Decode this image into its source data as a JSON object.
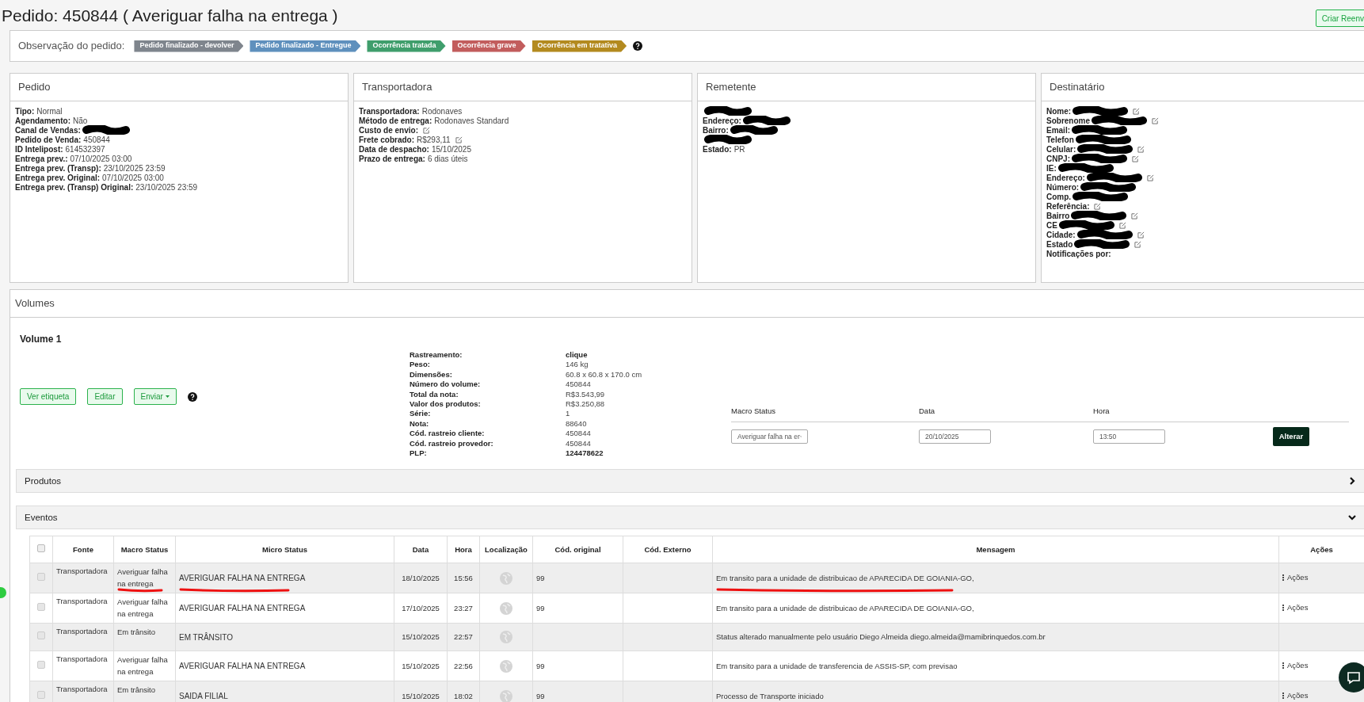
{
  "title": "Pedido: 450844 ( Averiguar falha na entrega )",
  "top_button": "Criar Reenv",
  "observation": {
    "label": "Observação do pedido:",
    "tags": [
      {
        "label": "Pedido finalizado - devolver",
        "color": "#7f858d"
      },
      {
        "label": "Pedido finalizado - Entregue",
        "color": "#5f90bd"
      },
      {
        "label": "Ocorrência tratada",
        "color": "#3f9e6c"
      },
      {
        "label": "Ocorrência grave",
        "color": "#c25d5d"
      },
      {
        "label": "Ocorrência em tratativa",
        "color": "#b38a1f"
      }
    ]
  },
  "panels": [
    {
      "title": "Pedido",
      "fields": [
        {
          "label": "Tipo:",
          "value": "Normal"
        },
        {
          "label": "Agendamento:",
          "value": "Não"
        },
        {
          "label": "Canal de Vendas:",
          "redacted": true
        },
        {
          "label": "Pedido de Venda:",
          "value": "450844"
        },
        {
          "label": "ID Intelipost:",
          "value": "614532397"
        },
        {
          "label": "Entrega prev.:",
          "value": "07/10/2025 03:00"
        },
        {
          "label": "Entrega prev. (Transp):",
          "value": "23/10/2025 23:59"
        },
        {
          "label": "Entrega prev. Original:",
          "value": "07/10/2025 03:00"
        },
        {
          "label": "Entrega prev. (Transp) Original:",
          "value": "23/10/2025 23:59"
        }
      ]
    },
    {
      "title": "Transportadora",
      "fields": [
        {
          "label": "Transportadora:",
          "value": "Rodonaves"
        },
        {
          "label": "Método de entrega:",
          "value": "Rodonaves Standard"
        },
        {
          "label": "Custo de envio:",
          "editable": true
        },
        {
          "label": "Frete cobrado:",
          "value": "R$293,11",
          "editable": true
        },
        {
          "label": "Data de despacho:",
          "value": "15/10/2025"
        },
        {
          "label": "Prazo de entrega:",
          "value": "6 dias úteis"
        }
      ]
    },
    {
      "title": "Remetente",
      "fields": [
        {
          "redacted": true
        },
        {
          "label": "Endereço:",
          "redacted": true
        },
        {
          "label": "Bairro:",
          "redacted": true
        },
        {
          "redacted": true
        },
        {
          "label": "Estado:",
          "value": "PR"
        }
      ]
    },
    {
      "title": "Destinatário",
      "fields": [
        {
          "label": "Nome:",
          "redacted": true,
          "editable": true
        },
        {
          "label": "Sobrenome",
          "redacted": true,
          "editable": true
        },
        {
          "label": "Email:",
          "redacted": true
        },
        {
          "label": "Telefon",
          "redacted": true
        },
        {
          "label": "Celular:",
          "redacted": true,
          "editable": true
        },
        {
          "label": "CNPJ:",
          "redacted": true,
          "editable": true
        },
        {
          "label": "IE:",
          "redacted": true
        },
        {
          "label": "Endereço:",
          "redacted": true,
          "editable": true
        },
        {
          "label": "Número:",
          "redacted": true
        },
        {
          "label": "Comp.",
          "redacted": true
        },
        {
          "label": "Referência:",
          "editable": true
        },
        {
          "label": "Bairro",
          "redacted": true,
          "editable": true
        },
        {
          "label": "CE",
          "redacted": true,
          "editable": true
        },
        {
          "label": "Cidade:",
          "redacted": true,
          "editable": true
        },
        {
          "label": "Estado",
          "redacted": true,
          "editable": true
        },
        {
          "label": "Notificações por:"
        }
      ]
    }
  ],
  "volumes": {
    "title": "Volumes",
    "volume_title": "Volume 1",
    "buttons": [
      {
        "label": "Ver etiqueta",
        "kind": "plain"
      },
      {
        "label": "Editar",
        "kind": "plain"
      },
      {
        "label": "Enviar",
        "kind": "dropdown"
      }
    ],
    "details": [
      {
        "label": "Rastreamento:",
        "value": "clique"
      },
      {
        "label": "Peso:",
        "value": "146 kg"
      },
      {
        "label": "Dimensões:",
        "value": "60.8 x 60.8 x 170.0 cm"
      },
      {
        "label": "Número do volume:",
        "value": "450844"
      },
      {
        "label": "Total da nota:",
        "value": "R$3.543,99"
      },
      {
        "label": "Valor dos produtos:",
        "value": "R$3.250,88"
      },
      {
        "label": "Série:",
        "value": "1"
      },
      {
        "label": "Nota:",
        "value": "88640"
      },
      {
        "label": "Cód. rastreio cliente:",
        "value": "450844"
      },
      {
        "label": "Cód. rastreio provedor:",
        "value": "450844"
      },
      {
        "label": "PLP:",
        "value": "124478622"
      }
    ],
    "status_form": {
      "macro_label": "Macro Status",
      "macro_value": "Averiguar falha na er",
      "date_label": "Data",
      "date_value": "20/10/2025",
      "time_label": "Hora",
      "time_value": "13:50",
      "button": "Alterar"
    }
  },
  "sections": [
    {
      "title": "Produtos",
      "expanded": false
    },
    {
      "title": "Eventos",
      "expanded": true
    }
  ],
  "events": {
    "select_all_checked": false,
    "columns": [
      "Fonte",
      "Macro Status",
      "Micro Status",
      "Data",
      "Hora",
      "Localização",
      "Cód. original",
      "Cód. Externo",
      "Mensagem",
      "Ações"
    ],
    "rows": [
      {
        "checked": false,
        "marked": true,
        "source": "Transportadora",
        "macro_status": "Averiguar falha na entrega",
        "micro_status": "AVERIGUAR FALHA NA ENTREGA",
        "date": "18/10/2025",
        "time": "15:56",
        "original_code": "99",
        "message": "Em transito para a unidade de distribuicao de APARECIDA DE GOIANIA-GO,",
        "actions": "Ações"
      },
      {
        "checked": false,
        "marked": false,
        "source": "Transportadora",
        "macro_status": "Averiguar falha na entrega",
        "micro_status": "AVERIGUAR FALHA NA ENTREGA",
        "date": "17/10/2025",
        "time": "23:27",
        "original_code": "99",
        "message": "Em transito para a unidade de distribuicao de APARECIDA DE GOIANIA-GO,",
        "actions": "Ações"
      },
      {
        "checked": false,
        "marked": false,
        "source": "Transportadora",
        "macro_status": "Em trânsito",
        "micro_status": "EM TRÂNSITO",
        "date": "15/10/2025",
        "time": "22:57",
        "message": "Status alterado manualmente pelo usuário Diego Almeida diego.almeida@mamibrinquedos.com.br"
      },
      {
        "checked": false,
        "marked": false,
        "source": "Transportadora",
        "macro_status": "Averiguar falha na entrega",
        "micro_status": "AVERIGUAR FALHA NA ENTREGA",
        "date": "15/10/2025",
        "time": "22:56",
        "original_code": "99",
        "message": "Em transito para a unidade de transferencia de ASSIS-SP, com previsao",
        "actions": "Ações"
      },
      {
        "checked": false,
        "marked": false,
        "source": "Transportadora",
        "macro_status": "Em trânsito",
        "micro_status": "SAIDA FILIAL",
        "date": "15/10/2025",
        "time": "18:02",
        "original_code": "99",
        "message": "Processo de Transporte iniciado",
        "actions": "Ações"
      }
    ]
  }
}
